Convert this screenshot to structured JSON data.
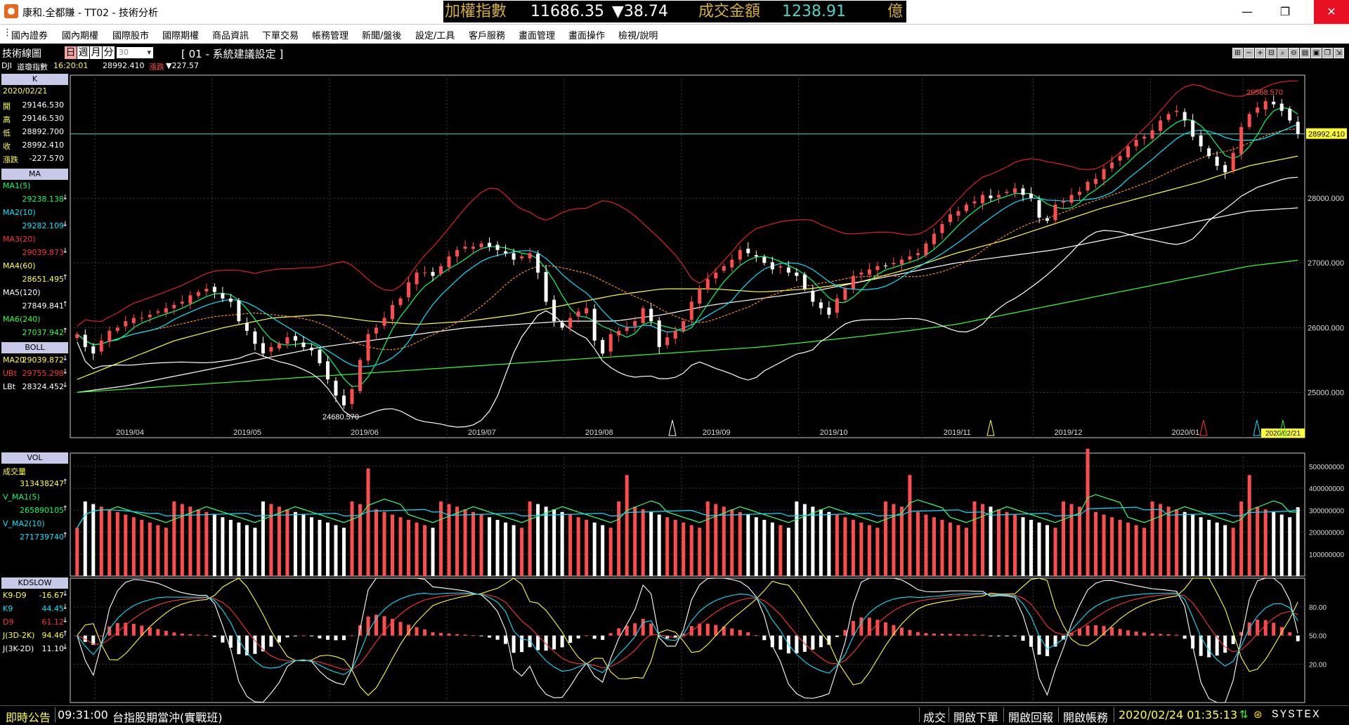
{
  "window": {
    "title": "康和.全都賺 - TT02 - 技術分析",
    "minimize": "—",
    "maximize": "❐",
    "close": "✕"
  },
  "ticker": {
    "index_label": "加權指數",
    "index_value": "11686.35",
    "index_change": "▼38.74",
    "amount_label": "成交金額",
    "amount_value": "1238.91",
    "amount_unit": "億",
    "colors": {
      "label": "#d4af37",
      "value": "#ffffff",
      "down": "#ffffff",
      "amount": "#4fd3c4"
    }
  },
  "menu": [
    "國內證券",
    "國內期權",
    "國際股市",
    "國際期權",
    "商品資訊",
    "下單交易",
    "帳務管理",
    "新聞/盤後",
    "設定/工具",
    "客戶服務",
    "畫面管理",
    "畫面操作",
    "檢視/說明"
  ],
  "toolbar": {
    "panel_title": "技術線圖",
    "periods": [
      "日",
      "週",
      "月",
      "分"
    ],
    "period_count": "30",
    "system_setting": "[ 01 - 系統建議設定 ]",
    "icons": [
      "zoom-in-icon",
      "minus-icon",
      "plus-icon",
      "collapse-icon",
      "search-icon",
      "zoom-out-icon",
      "print-icon",
      "save-icon",
      "window-icon",
      "export-icon"
    ]
  },
  "info": {
    "symbol": "DJI",
    "name": "道瓊指數",
    "time": "16:20:01",
    "price": "28992.410",
    "change_label": "漲跌",
    "change": "▼227.57"
  },
  "left_panel": {
    "k": {
      "header": "K",
      "date": "2020/02/21",
      "rows": [
        {
          "k": "開",
          "v": "29146.530"
        },
        {
          "k": "高",
          "v": "29146.530"
        },
        {
          "k": "低",
          "v": "28892.700"
        },
        {
          "k": "收",
          "v": "28992.410"
        },
        {
          "k": "漲跌",
          "v": "-227.570"
        }
      ]
    },
    "ma": {
      "header": "MA",
      "rows": [
        {
          "k": "MA1(5)",
          "v": "29238.138",
          "color": "#00ff66",
          "arrow": "↓"
        },
        {
          "k": "MA2(10)",
          "v": "29282.109",
          "color": "#00e5ff",
          "arrow": "↓"
        },
        {
          "k": "MA3(20)",
          "v": "29039.873",
          "color": "#ff3333",
          "arrow": "↓"
        },
        {
          "k": "MA4(60)",
          "v": "28651.495",
          "color": "#ffff33",
          "arrow": "↑"
        },
        {
          "k": "MA5(120)",
          "v": "27849.841",
          "color": "#ffffff",
          "arrow": "↑"
        },
        {
          "k": "MA6(240)",
          "v": "27037.942",
          "color": "#33ff33",
          "arrow": "↑"
        }
      ]
    },
    "boll": {
      "header": "BOLL",
      "rows": [
        {
          "k": "MA20",
          "v": "29039.872",
          "color": "#ffff33",
          "arrow": "↓"
        },
        {
          "k": "UBt",
          "v": "29755.298",
          "color": "#ff3333",
          "arrow": "↓"
        },
        {
          "k": "LBt",
          "v": "28324.452",
          "color": "#ffffff",
          "arrow": "↓"
        }
      ]
    },
    "vol": {
      "header": "VOL",
      "rows": [
        {
          "k": "成交量",
          "v": "",
          "color": "#ffff33",
          "arrow": ""
        },
        {
          "k": "",
          "v": "313438247",
          "color": "#ffff33",
          "arrow": "↑"
        },
        {
          "k": "V_MA1(5)",
          "v": "",
          "color": "#00ff66",
          "arrow": ""
        },
        {
          "k": "",
          "v": "265890105",
          "color": "#00ff66",
          "arrow": "↑"
        },
        {
          "k": "V_MA2(10)",
          "v": "",
          "color": "#00e5ff",
          "arrow": ""
        },
        {
          "k": "",
          "v": "271739740",
          "color": "#00e5ff",
          "arrow": "↑"
        }
      ]
    },
    "kd": {
      "header": "KDSLOW",
      "rows": [
        {
          "k": "K9-D9",
          "v": "-16.67",
          "color": "#ffff33",
          "arrow": "↓"
        },
        {
          "k": "K9",
          "v": "44.45",
          "color": "#00e5ff",
          "arrow": "↓"
        },
        {
          "k": "D9",
          "v": "61.12",
          "color": "#ff3333",
          "arrow": "↓"
        },
        {
          "k": "J(3D-2K)",
          "v": "94.46",
          "color": "#ffff33",
          "arrow": "↑"
        },
        {
          "k": "J(3K-2D)",
          "v": "11.10",
          "color": "#ffffff",
          "arrow": "↓"
        }
      ]
    }
  },
  "chart_data": [
    {
      "type": "candlestick",
      "x_labels": [
        "2019/04",
        "2019/05",
        "2019/06",
        "2019/07",
        "2019/08",
        "2019/09",
        "2019/10",
        "2019/11",
        "2019/12",
        "2020/01",
        "2020/02"
      ],
      "last_date": "2020/02/21",
      "y_ticks": [
        "28000.000",
        "27000.000",
        "26000.000",
        "25000.000"
      ],
      "ylim": [
        24300,
        29900
      ],
      "current_price": "28992.410",
      "annotations": {
        "high": "29568.570",
        "low": "24680.570"
      },
      "closes": [
        25900,
        25700,
        25600,
        25800,
        25950,
        26000,
        26100,
        26150,
        26150,
        26200,
        26250,
        26300,
        26350,
        26400,
        26500,
        26550,
        26600,
        26550,
        26450,
        26400,
        26100,
        25950,
        25750,
        25600,
        25700,
        25750,
        25850,
        25800,
        25700,
        25650,
        25450,
        25200,
        24950,
        24800,
        25050,
        25500,
        25900,
        26000,
        26150,
        26350,
        26450,
        26700,
        26850,
        26850,
        26800,
        26950,
        27100,
        27200,
        27250,
        27250,
        27300,
        27250,
        27200,
        27150,
        27050,
        27100,
        27150,
        26850,
        26400,
        26100,
        26000,
        26150,
        26250,
        26300,
        25800,
        25600,
        25900,
        25950,
        26000,
        26100,
        26300,
        26100,
        25700,
        25850,
        25950,
        26100,
        26400,
        26600,
        26750,
        26850,
        26950,
        27050,
        27200,
        27150,
        27100,
        27000,
        26900,
        26950,
        26850,
        26800,
        26600,
        26400,
        26300,
        26200,
        26450,
        26600,
        26800,
        26850,
        26900,
        26950,
        26950,
        27000,
        27050,
        27100,
        27150,
        27300,
        27450,
        27600,
        27750,
        27800,
        27900,
        27950,
        28050,
        28000,
        28050,
        28100,
        28150,
        28050,
        28000,
        27700,
        27650,
        27900,
        27950,
        28050,
        28100,
        28250,
        28300,
        28450,
        28550,
        28650,
        28800,
        28900,
        28950,
        29050,
        29200,
        29300,
        29350,
        29200,
        28950,
        28800,
        28650,
        28500,
        28400,
        28700,
        29100,
        29300,
        29400,
        29500,
        29450,
        29350,
        29200,
        28992
      ],
      "ma_series": [
        {
          "name": "MA4(60)",
          "color": "#ffff33",
          "values": [
            25200,
            25500,
            25800,
            26000,
            26150,
            26200,
            26100,
            26050,
            26100,
            26200,
            26350,
            26500,
            26600,
            26600,
            26550,
            26600,
            26700,
            26900,
            27150,
            27350,
            27600,
            27850,
            28050,
            28250,
            28500,
            28650
          ]
        },
        {
          "name": "MA5(120)",
          "color": "#ffffff",
          "values": [
            25000,
            25100,
            25250,
            25400,
            25550,
            25700,
            25800,
            25900,
            26000,
            26050,
            26100,
            26100,
            26200,
            26350,
            26450,
            26550,
            26700,
            26850,
            27000,
            27100,
            27200,
            27350,
            27500,
            27650,
            27800,
            27850
          ]
        },
        {
          "name": "MA6(240)",
          "color": "#33ff33",
          "values": [
            25000,
            25050,
            25100,
            25150,
            25200,
            25250,
            25300,
            25350,
            25400,
            25450,
            25500,
            25550,
            25600,
            25650,
            25700,
            25780,
            25860,
            25950,
            26050,
            26200,
            26350,
            26500,
            26650,
            26800,
            26950,
            27040
          ]
        }
      ]
    },
    {
      "type": "bar",
      "name": "VOL",
      "y_ticks": [
        "500000000",
        "400000000",
        "300000000",
        "200000000",
        "100000000"
      ],
      "ylim": [
        0,
        560000000
      ],
      "last_value": 313438247
    },
    {
      "type": "line",
      "name": "KDSLOW",
      "y_ticks": [
        "80.00",
        "50.00",
        "20.00"
      ],
      "ylim": [
        -20,
        110
      ]
    }
  ],
  "colors": {
    "up": "#ff4d4d",
    "down": "#ffffff",
    "grid": "#3a3a3a",
    "axis": "#cccccc",
    "panel_head": "#c8c8e8"
  },
  "statusbar": {
    "notice_label": "即時公告",
    "notice_time": "09:31:00",
    "notice_text": "台指股期當沖(實戰班)",
    "links": [
      "成交",
      "開啟下單",
      "開啟回報",
      "開啟帳務"
    ],
    "datetime": "2020/02/24 01:35:13",
    "brand": "SYSTEX"
  }
}
